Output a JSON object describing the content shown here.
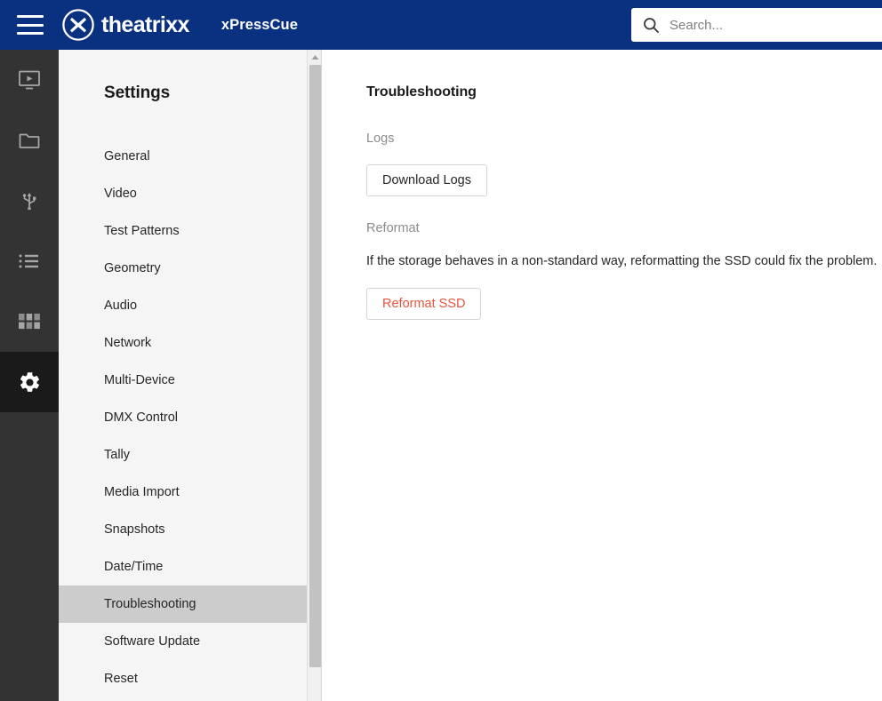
{
  "header": {
    "menu_icon": "hamburger-menu-icon",
    "logo_icon": "theatrixx-logo-icon",
    "brand": "theatrixx",
    "app_name": "xPressCue",
    "search": {
      "icon": "search-icon",
      "placeholder": "Search...",
      "value": ""
    },
    "background_color": "#0a3080"
  },
  "icon_rail": {
    "background_color": "#333333",
    "active_background_color": "#1a1a1a",
    "items": [
      {
        "name": "playback-monitor-icon",
        "label": "Playback",
        "active": false
      },
      {
        "name": "folder-icon",
        "label": "Media",
        "active": false
      },
      {
        "name": "usb-icon",
        "label": "USB",
        "active": false
      },
      {
        "name": "list-icon",
        "label": "Playlist",
        "active": false
      },
      {
        "name": "grid-icon",
        "label": "Grid",
        "active": false
      },
      {
        "name": "gear-icon",
        "label": "Settings",
        "active": true
      }
    ]
  },
  "sidebar": {
    "title": "Settings",
    "selected": "Troubleshooting",
    "selected_background_color": "#cccccc",
    "items": [
      {
        "label": "General"
      },
      {
        "label": "Video"
      },
      {
        "label": "Test Patterns"
      },
      {
        "label": "Geometry"
      },
      {
        "label": "Audio"
      },
      {
        "label": "Network"
      },
      {
        "label": "Multi-Device"
      },
      {
        "label": "DMX Control"
      },
      {
        "label": "Tally"
      },
      {
        "label": "Media Import"
      },
      {
        "label": "Snapshots"
      },
      {
        "label": "Date/Time"
      },
      {
        "label": "Troubleshooting"
      },
      {
        "label": "Software Update"
      },
      {
        "label": "Reset"
      }
    ],
    "scrollbar": {
      "up_arrow_icon": "scroll-up-arrow-icon",
      "thumb_color": "#c2c2c2"
    }
  },
  "main": {
    "title": "Troubleshooting",
    "logs": {
      "label": "Logs",
      "download_button": "Download Logs"
    },
    "reformat": {
      "label": "Reformat",
      "description": "If the storage behaves in a non-standard way, reformatting the SSD could fix the problem.",
      "button": "Reformat SSD",
      "button_color": "#e8553f"
    }
  }
}
